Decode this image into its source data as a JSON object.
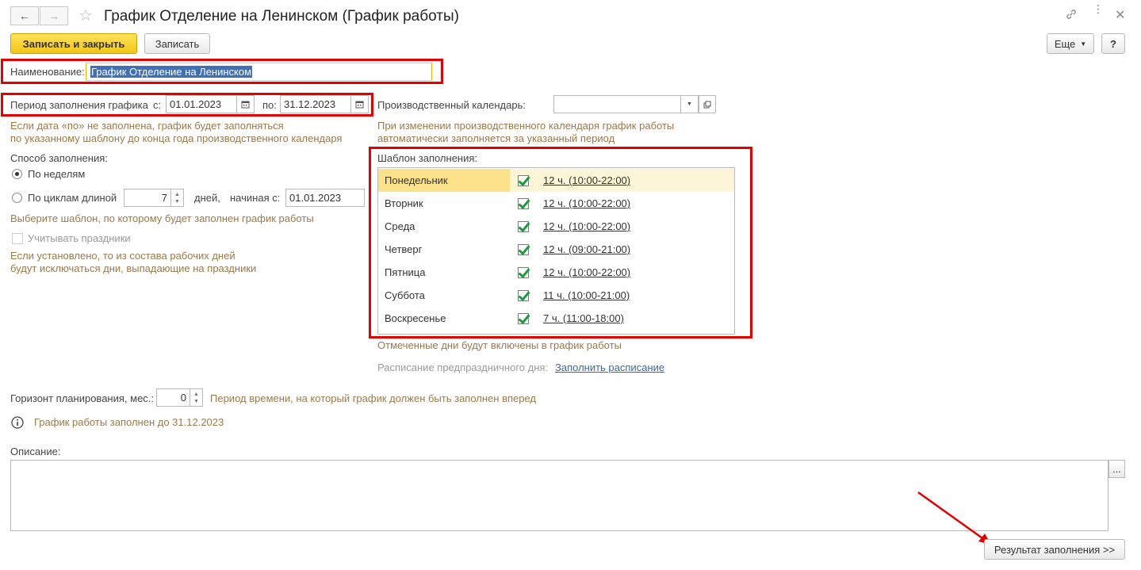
{
  "window": {
    "title": "График Отделение на Ленинском (График работы)"
  },
  "toolbar": {
    "save_close_label": "Записать и закрыть",
    "save_label": "Записать",
    "more_label": "Еще",
    "help_label": "?"
  },
  "name_field": {
    "label": "Наименование:",
    "value": "График Отделение на Ленинском"
  },
  "period": {
    "label": "Период заполнения графика",
    "from_label": "с:",
    "from_value": "01.01.2023",
    "to_label": "по:",
    "to_value": "31.12.2023",
    "hint_line1": "Если дата «по» не заполнена, график будет заполняться",
    "hint_line2": "по указанному шаблону до конца года производственного календаря"
  },
  "calendar": {
    "label": "Производственный календарь:",
    "value": "",
    "hint_line1": "При изменении производственного календаря график работы",
    "hint_line2": "автоматически заполняется за указанный период"
  },
  "fill_method": {
    "label": "Способ заполнения:",
    "option_weeks": "По неделям",
    "option_cycles": "По циклам длиной",
    "cycle_length": "7",
    "days_label": "дней,",
    "starting_label": "начиная с:",
    "start_date": "01.01.2023",
    "hint": "Выберите шаблон, по которому будет заполнен график работы",
    "holidays_label": "Учитывать праздники",
    "holidays_hint_line1": "Если установлено, то из состава рабочих дней",
    "holidays_hint_line2": "будут исключаться дни, выпадающие на праздники"
  },
  "template": {
    "label": "Шаблон заполнения:",
    "days": [
      {
        "day": "Понедельник",
        "hours": "12 ч. (10:00-22:00)"
      },
      {
        "day": "Вторник",
        "hours": "12 ч. (10:00-22:00)"
      },
      {
        "day": "Среда",
        "hours": "12 ч. (10:00-22:00)"
      },
      {
        "day": "Четверг",
        "hours": "12 ч. (09:00-21:00)"
      },
      {
        "day": "Пятница",
        "hours": "12 ч. (10:00-22:00)"
      },
      {
        "day": "Суббота",
        "hours": "11 ч. (10:00-21:00)"
      },
      {
        "day": "Воскресенье",
        "hours": "7 ч. (11:00-18:00)"
      }
    ],
    "hint": "Отмеченные дни будут включены в график работы",
    "pre_holiday_label": "Расписание предпраздничного дня:",
    "pre_holiday_link": "Заполнить расписание"
  },
  "horizon": {
    "label": "Горизонт планирования, мес.:",
    "value": "0",
    "hint": "Период времени, на который график должен быть заполнен вперед"
  },
  "info": {
    "text": "График работы заполнен до 31.12.2023"
  },
  "description": {
    "label": "Описание:",
    "value": "",
    "more_label": "..."
  },
  "result_button": {
    "label": "Результат заполнения >>"
  },
  "colors": {
    "accent_yellow": "#f4c515",
    "highlight_red": "#e30000",
    "selected_row": "#fce28a",
    "check_green": "#1c9b3c"
  }
}
